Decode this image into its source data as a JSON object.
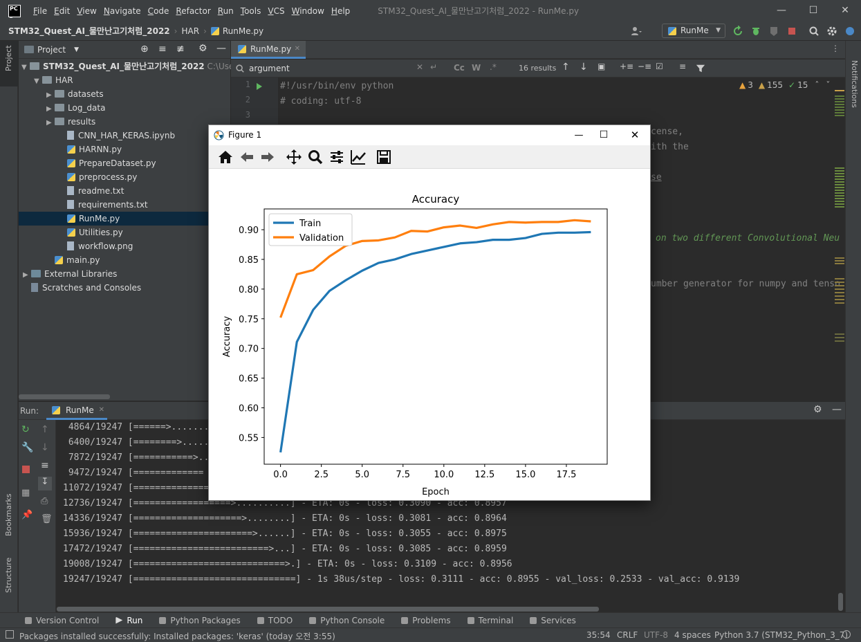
{
  "app": {
    "window_title": "STM32_Quest_AI_물만난고기처럼_2022 - RunMe.py",
    "menu": [
      "File",
      "Edit",
      "View",
      "Navigate",
      "Code",
      "Refactor",
      "Run",
      "Tools",
      "VCS",
      "Window",
      "Help"
    ]
  },
  "navbar": {
    "project": "STM32_Quest_AI_물만난고기처럼_2022",
    "folder": "HAR",
    "file": "RunMe.py",
    "run_config": "RunMe"
  },
  "project_pane": {
    "title": "Project",
    "root": "STM32_Quest_AI_물만난고기처럼_2022",
    "root_path": "C:\\User",
    "items": [
      {
        "label": "HAR",
        "kind": "folder"
      },
      {
        "label": "datasets",
        "kind": "folder"
      },
      {
        "label": "Log_data",
        "kind": "folder"
      },
      {
        "label": "results",
        "kind": "folder"
      },
      {
        "label": "CNN_HAR_KERAS.ipynb",
        "kind": "file"
      },
      {
        "label": "HARNN.py",
        "kind": "py"
      },
      {
        "label": "PrepareDataset.py",
        "kind": "py"
      },
      {
        "label": "preprocess.py",
        "kind": "py"
      },
      {
        "label": "readme.txt",
        "kind": "file"
      },
      {
        "label": "requirements.txt",
        "kind": "file"
      },
      {
        "label": "RunMe.py",
        "kind": "py"
      },
      {
        "label": "Utilities.py",
        "kind": "py"
      },
      {
        "label": "workflow.png",
        "kind": "file"
      },
      {
        "label": "main.py",
        "kind": "py"
      },
      {
        "label": "External Libraries",
        "kind": "lib"
      },
      {
        "label": "Scratches and Consoles",
        "kind": "scratch"
      }
    ]
  },
  "editor": {
    "tab": "RunMe.py",
    "search_value": "argument",
    "results": "16 results",
    "inspections": {
      "warnings": "3",
      "weak": "155",
      "ok": "15"
    },
    "line_numbers": [
      "1",
      "2",
      "3"
    ],
    "code_lines": [
      "#!/usr/bin/env python",
      "# coding: utf-8"
    ],
    "partial": {
      "license": "cense,",
      "with": "ith the",
      "se": "se",
      "comment": "on two different Convolutional Neu",
      "seed": "umber generator for numpy and tenso"
    }
  },
  "run": {
    "label": "Run:",
    "tab": "RunMe",
    "lines": [
      " 4864/19247 [======>.......",
      " 6400/19247 [========>.....",
      " 7872/19247 [===========>..",
      " 9472/19247 [=============",
      "11072/19247 [================",
      "12736/19247 [==================>..........] - ETA: 0s - loss: 0.3090 - acc: 0.8957",
      "14336/19247 [====================>........] - ETA: 0s - loss: 0.3081 - acc: 0.8964",
      "15936/19247 [======================>......] - ETA: 0s - loss: 0.3055 - acc: 0.8975",
      "17472/19247 [=========================>...] - ETA: 0s - loss: 0.3085 - acc: 0.8959",
      "19008/19247 [============================>.] - ETA: 0s - loss: 0.3109 - acc: 0.8956",
      "19247/19247 [==============================] - 1s 38us/step - loss: 0.3111 - acc: 0.8955 - val_loss: 0.2533 - val_acc: 0.9139"
    ]
  },
  "toolwindows": [
    "Version Control",
    "Run",
    "Python Packages",
    "TODO",
    "Python Console",
    "Problems",
    "Terminal",
    "Services"
  ],
  "left_strip": [
    "Project",
    "Bookmarks",
    "Structure"
  ],
  "right_strip": [
    "Notifications"
  ],
  "status": {
    "message": "Packages installed successfully: Installed packages: 'keras' (today 오전 3:55)",
    "position": "35:54",
    "line_sep": "CRLF",
    "encoding": "UTF-8",
    "indent": "4 spaces",
    "interpreter": "Python 3.7 (STM32_Python_3_7)"
  },
  "figure": {
    "window_title": "Figure 1",
    "chart_data": {
      "type": "line",
      "title": "Accuracy",
      "xlabel": "Epoch",
      "ylabel": "Accuracy",
      "xlim": [
        -1,
        20
      ],
      "ylim": [
        0.505,
        0.935
      ],
      "xticks": [
        0.0,
        2.5,
        5.0,
        7.5,
        10.0,
        12.5,
        15.0,
        17.5
      ],
      "yticks": [
        0.55,
        0.6,
        0.65,
        0.7,
        0.75,
        0.8,
        0.85,
        0.9
      ],
      "legend_position": "top-left",
      "x": [
        0,
        1,
        2,
        3,
        4,
        5,
        6,
        7,
        8,
        9,
        10,
        11,
        12,
        13,
        14,
        15,
        16,
        17,
        18,
        19
      ],
      "series": [
        {
          "name": "Train",
          "color": "#1f77b4",
          "values": [
            0.525,
            0.711,
            0.765,
            0.797,
            0.815,
            0.831,
            0.844,
            0.85,
            0.859,
            0.865,
            0.871,
            0.877,
            0.879,
            0.883,
            0.883,
            0.886,
            0.893,
            0.895,
            0.895,
            0.896
          ]
        },
        {
          "name": "Validation",
          "color": "#ff7f0e",
          "values": [
            0.752,
            0.825,
            0.832,
            0.855,
            0.873,
            0.881,
            0.882,
            0.887,
            0.898,
            0.897,
            0.904,
            0.907,
            0.903,
            0.909,
            0.913,
            0.912,
            0.913,
            0.913,
            0.916,
            0.914
          ]
        }
      ]
    }
  }
}
